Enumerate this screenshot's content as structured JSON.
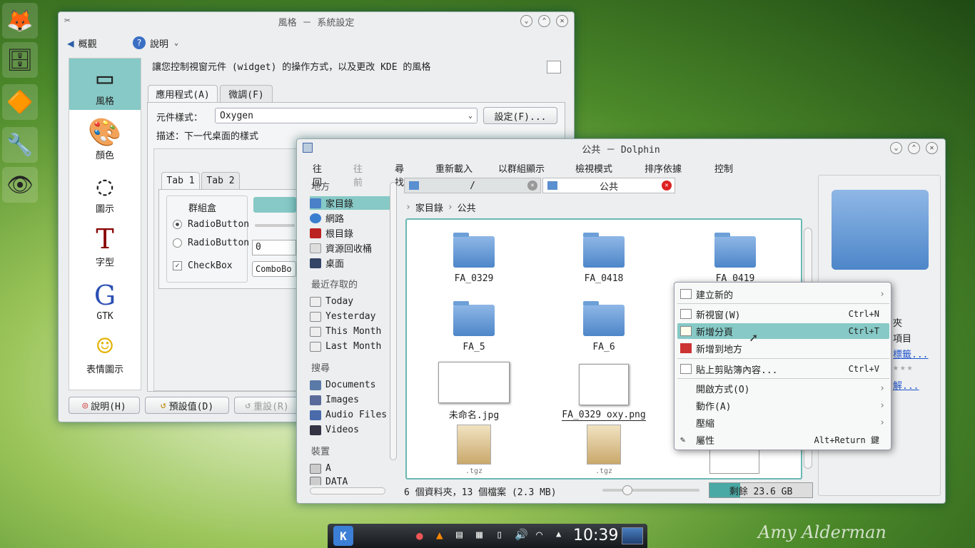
{
  "dock": {
    "items": [
      {
        "icon": "firefox-icon",
        "glyph": "🦊"
      },
      {
        "icon": "file-manager-icon",
        "glyph": "🗄"
      },
      {
        "icon": "vlc-icon",
        "glyph": "🔶"
      },
      {
        "icon": "settings-tools-icon",
        "glyph": "🔧"
      },
      {
        "icon": "eye-icon",
        "glyph": "👁"
      }
    ]
  },
  "settings": {
    "title": "風格 － 系統設定",
    "toolbar": {
      "overview": "概觀",
      "help": "說明"
    },
    "description": "讓您控制視窗元件 (widget) 的操作方式，以及更改 KDE 的風格",
    "categories": [
      "風格",
      "顏色",
      "圖示",
      "字型",
      "GTK",
      "表情圖示"
    ],
    "category_glyphs": [
      "▭",
      "🎨",
      "◌",
      "T",
      "G",
      "☺"
    ],
    "tabs": [
      "應用程式(A)",
      "微調(F)"
    ],
    "widget_style_label": "元件樣式：",
    "widget_style_value": "Oxygen",
    "configure": "設定(F)...",
    "desc_label": "描述：下一代桌面的樣式",
    "preview_tabs": [
      "Tab 1",
      "Tab 2"
    ],
    "groupbox": "群組盒",
    "radio1": "RadioButton",
    "radio2": "RadioButton",
    "checkbox": "CheckBox",
    "spin_value": "0",
    "combo_value": "ComboBo",
    "bottom": {
      "help": "說明(H)",
      "defaults": "預設值(D)",
      "reset": "重設(R)"
    }
  },
  "dolphin": {
    "title": "公共 － Dolphin",
    "menu": [
      "往回",
      "往前",
      "尋找",
      "重新載入",
      "以群組顯示",
      "檢視模式",
      "排序依據",
      "控制"
    ],
    "places_header": "地方",
    "places": [
      "家目錄",
      "網路",
      "根目錄",
      "資源回收桶",
      "桌面"
    ],
    "recent_header": "最近存取的",
    "recent": [
      "Today",
      "Yesterday",
      "This Month",
      "Last Month"
    ],
    "search_header": "搜尋",
    "search": [
      "Documents",
      "Images",
      "Audio Files",
      "Videos"
    ],
    "devices_header": "裝置",
    "devices": [
      "A",
      "DATA"
    ],
    "tab1": "/",
    "tab2": "公共",
    "breadcrumb": [
      "家目錄",
      "公共"
    ],
    "files": [
      "FA_0329",
      "FA_0418",
      "FA_0419",
      "FA_5",
      "FA_6",
      "未命名.jpg",
      "FA_0329 oxy.png",
      "",
      ".tgz",
      ".tgz"
    ],
    "tgz": ".tgz",
    "status": "6 個資料夾，13 個檔案 (2.3 MB)",
    "free": "剩餘 23.6 GB",
    "info_partial": [
      "夾",
      "項目",
      "標籤...",
      "",
      "解..."
    ]
  },
  "context_menu": {
    "items": [
      {
        "label": "建立新的",
        "shortcut": "",
        "arrow": "›"
      },
      {
        "label": "新視窗(W)",
        "shortcut": "Ctrl+N",
        "arrow": ""
      },
      {
        "label": "新增分頁",
        "shortcut": "Ctrl+T",
        "arrow": ""
      },
      {
        "label": "新增到地方",
        "shortcut": "",
        "arrow": ""
      },
      {
        "label": "貼上剪貼簿內容...",
        "shortcut": "Ctrl+V",
        "arrow": ""
      },
      {
        "label": "開啟方式(O)",
        "shortcut": "",
        "arrow": "›"
      },
      {
        "label": "動作(A)",
        "shortcut": "",
        "arrow": "›"
      },
      {
        "label": "壓縮",
        "shortcut": "",
        "arrow": "›"
      },
      {
        "label": "屬性",
        "shortcut": "Alt+Return 鍵",
        "arrow": ""
      }
    ]
  },
  "taskbar": {
    "clock": "10:39"
  },
  "signature": "Amy Alderman"
}
